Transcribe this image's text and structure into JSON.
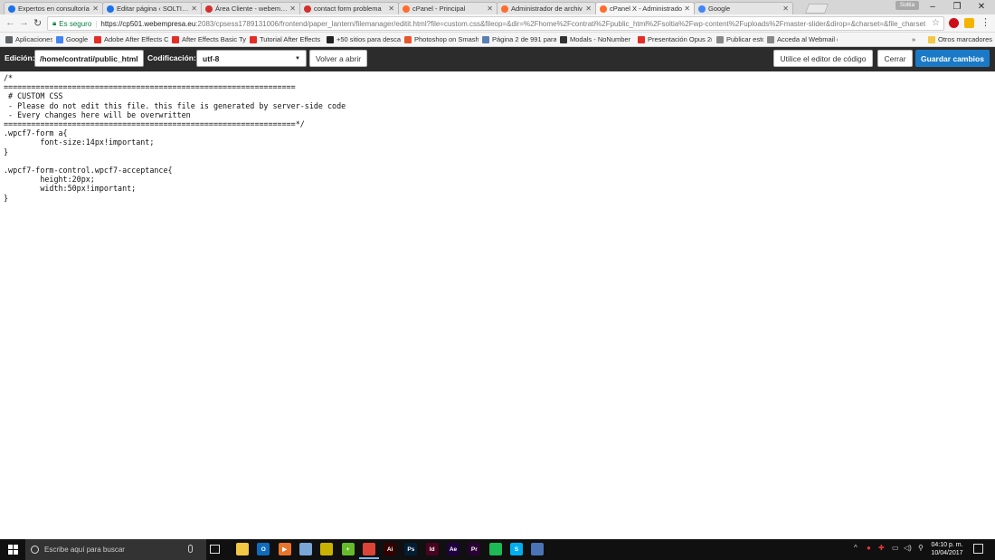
{
  "browser": {
    "tabs": [
      {
        "label": "Expertos en consultoría",
        "favicon_color": "#1a73e8"
      },
      {
        "label": "Editar página ‹ SOLTIA —",
        "favicon_color": "#1a73e8"
      },
      {
        "label": "Área Cliente - webempre",
        "favicon_color": "#d32f2f"
      },
      {
        "label": "contact form problema",
        "favicon_color": "#d32f2f"
      },
      {
        "label": "cPanel - Principal",
        "favicon_color": "#ff6c2c"
      },
      {
        "label": "Administrador de archiv",
        "favicon_color": "#ff6c2c"
      },
      {
        "label": "cPanel X - Administrado",
        "favicon_color": "#ff6c2c"
      },
      {
        "label": "Google",
        "favicon_color": "#4285f4"
      }
    ],
    "user_badge": "Soltia",
    "security_text": "Es seguro",
    "url_host": "https://cp501.webempresa.eu",
    "url_rest": ":2083/cpsess1789131006/frontend/paper_lantern/filemanager/editit.html?file=custom.css&fileop=&dir=%2Fhome%2Fcontrati%2Fpublic_html%2Fsoltia%2Fwp-content%2Fuploads%2Fmaster-slider&dirop=&charset=&file_charset",
    "bookmarks": [
      {
        "label": "Aplicaciones",
        "icon_color": "#5f6368"
      },
      {
        "label": "Google",
        "icon_color": "#4285f4"
      },
      {
        "label": "Adobe After Effects C",
        "icon_color": "#e52d27"
      },
      {
        "label": "After Effects Basic Typ",
        "icon_color": "#e52d27"
      },
      {
        "label": "Tutorial After Effects",
        "icon_color": "#e52d27"
      },
      {
        "label": "+50 sitios para desca",
        "icon_color": "#222222"
      },
      {
        "label": "Photoshop on Smash",
        "icon_color": "#e8552b"
      },
      {
        "label": "Página 2 de 991 para",
        "icon_color": "#5b7fb5"
      },
      {
        "label": "Modals - NoNumber",
        "icon_color": "#333333"
      },
      {
        "label": "Presentación Opus 2(",
        "icon_color": "#e52d27"
      },
      {
        "label": "Publicar esto",
        "icon_color": "#888888"
      },
      {
        "label": "Acceda al Webmail de",
        "icon_color": "#888888"
      }
    ],
    "bookmarks_overflow": "»",
    "other_bookmarks": "Otros marcadores"
  },
  "toolbar": {
    "edition_label": "Edición:",
    "path_value": "/home/contrati/public_html",
    "encoding_label": "Codificación:",
    "encoding_value": "utf-8",
    "reopen_button": "Volver a abrir",
    "code_editor_button": "Utilice el editor de código",
    "close_button": "Cerrar",
    "save_button": "Guardar cambios"
  },
  "editor": {
    "content": "/*\n================================================================\n # CUSTOM CSS\n - Please do not edit this file. this file is generated by server-side code\n - Every changes here will be overwritten\n================================================================*/\n.wpcf7-form a{\n        font-size:14px!important;\n}\n\n.wpcf7-form-control.wpcf7-acceptance{\n        height:20px;\n        width:50px!important;\n}"
  },
  "taskbar": {
    "search_placeholder": "Escribe aquí para buscar",
    "apps": [
      {
        "name": "file-explorer",
        "glyph": "",
        "color": "#f2c744"
      },
      {
        "name": "outlook",
        "glyph": "O",
        "color": "#0f6cbd"
      },
      {
        "name": "media-player",
        "glyph": "▶",
        "color": "#e9742b"
      },
      {
        "name": "paint",
        "glyph": "",
        "color": "#7aa6d8"
      },
      {
        "name": "app-gold",
        "glyph": "",
        "color": "#c9b300"
      },
      {
        "name": "app-green",
        "glyph": "+",
        "color": "#66bb2a"
      },
      {
        "name": "chrome",
        "glyph": "",
        "color": "#db4437"
      },
      {
        "name": "illustrator",
        "glyph": "Ai",
        "color": "#330000"
      },
      {
        "name": "photoshop",
        "glyph": "Ps",
        "color": "#001e36"
      },
      {
        "name": "indesign",
        "glyph": "Id",
        "color": "#49021f"
      },
      {
        "name": "after-effects",
        "glyph": "Ae",
        "color": "#1f0040"
      },
      {
        "name": "premiere",
        "glyph": "Pr",
        "color": "#2a0034"
      },
      {
        "name": "spotify",
        "glyph": "",
        "color": "#1db954"
      },
      {
        "name": "skype",
        "glyph": "S",
        "color": "#00aff0"
      },
      {
        "name": "app-blue",
        "glyph": "",
        "color": "#4a74b5"
      }
    ],
    "time": "04:10 p. m.",
    "date": "10/04/2017"
  }
}
